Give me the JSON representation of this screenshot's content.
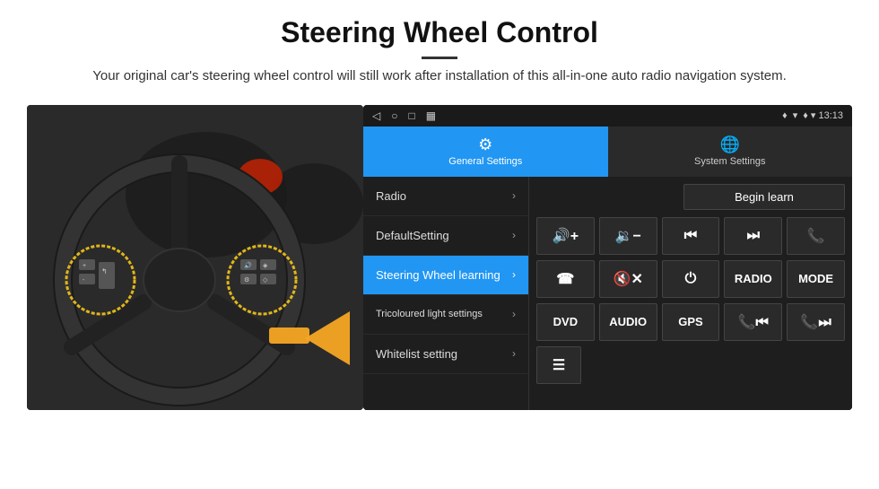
{
  "page": {
    "title": "Steering Wheel Control",
    "divider": true,
    "subtitle": "Your original car's steering wheel control will still work after installation of this all-in-one auto radio navigation system."
  },
  "status_bar": {
    "icons": [
      "◁",
      "○",
      "□",
      "▦"
    ],
    "right_icons": "♦ ▾ 13:13"
  },
  "tabs": [
    {
      "id": "general",
      "label": "General Settings",
      "icon": "⚙",
      "active": true
    },
    {
      "id": "system",
      "label": "System Settings",
      "icon": "🌐",
      "active": false
    }
  ],
  "menu_items": [
    {
      "id": "radio",
      "label": "Radio",
      "active": false
    },
    {
      "id": "default-setting",
      "label": "DefaultSetting",
      "active": false
    },
    {
      "id": "steering-wheel",
      "label": "Steering Wheel learning",
      "active": true
    },
    {
      "id": "tricoloured",
      "label": "Tricoloured light settings",
      "active": false
    },
    {
      "id": "whitelist",
      "label": "Whitelist setting",
      "active": false
    }
  ],
  "control_panel": {
    "begin_learn_label": "Begin learn",
    "rows": [
      [
        {
          "id": "vol-up",
          "label": "🔊+",
          "type": "icon"
        },
        {
          "id": "vol-down",
          "label": "🔇-",
          "type": "icon"
        },
        {
          "id": "prev-track",
          "label": "⏮",
          "type": "icon"
        },
        {
          "id": "next-track",
          "label": "⏭",
          "type": "icon"
        },
        {
          "id": "phone",
          "label": "📞",
          "type": "icon"
        }
      ],
      [
        {
          "id": "hook",
          "label": "☎",
          "type": "icon"
        },
        {
          "id": "mute",
          "label": "🔇✕",
          "type": "icon"
        },
        {
          "id": "power",
          "label": "⏻",
          "type": "icon"
        },
        {
          "id": "radio-btn",
          "label": "RADIO",
          "type": "text"
        },
        {
          "id": "mode-btn",
          "label": "MODE",
          "type": "text"
        }
      ],
      [
        {
          "id": "dvd-btn",
          "label": "DVD",
          "type": "text"
        },
        {
          "id": "audio-btn",
          "label": "AUDIO",
          "type": "text"
        },
        {
          "id": "gps-btn",
          "label": "GPS",
          "type": "text"
        },
        {
          "id": "tel-prev",
          "label": "📞⏮",
          "type": "icon"
        },
        {
          "id": "tel-next",
          "label": "📞⏭",
          "type": "icon"
        }
      ],
      [
        {
          "id": "menu-icon",
          "label": "☰",
          "type": "icon"
        }
      ]
    ]
  }
}
